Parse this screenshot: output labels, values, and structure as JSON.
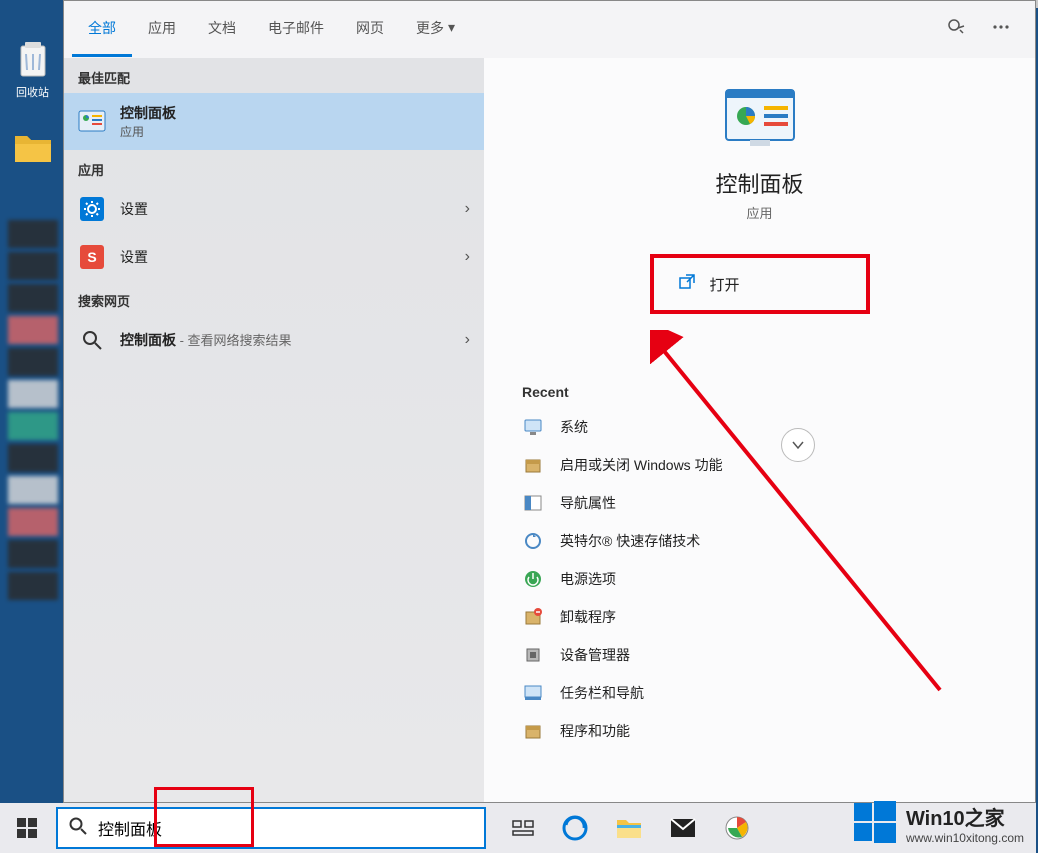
{
  "desktop": {
    "recycle_bin": "回收站"
  },
  "tabs": [
    "全部",
    "应用",
    "文档",
    "电子邮件",
    "网页",
    "更多"
  ],
  "sections": {
    "best_match": "最佳匹配",
    "apps": "应用",
    "search_web": "搜索网页"
  },
  "best_match_result": {
    "title": "控制面板",
    "subtitle": "应用"
  },
  "app_results": [
    {
      "label": "设置"
    },
    {
      "label": "设置"
    }
  ],
  "web_result": {
    "query": "控制面板",
    "suffix": " - 查看网络搜索结果"
  },
  "preview": {
    "title": "控制面板",
    "subtitle": "应用",
    "open_action": "打开",
    "recent_header": "Recent",
    "recent": [
      "系统",
      "启用或关闭 Windows 功能",
      "导航属性",
      "英特尔® 快速存储技术",
      "电源选项",
      "卸载程序",
      "设备管理器",
      "任务栏和导航",
      "程序和功能"
    ]
  },
  "search_input_value": "控制面板",
  "watermark": {
    "brand": "Win10之家",
    "url": "www.win10xitong.com"
  }
}
